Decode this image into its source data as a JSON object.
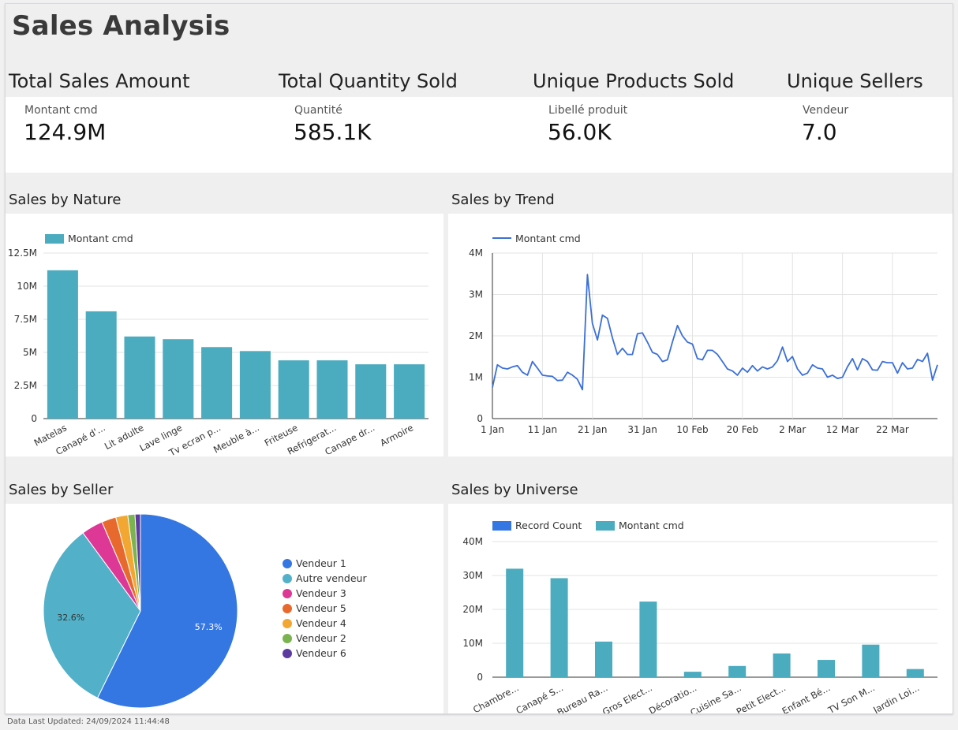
{
  "page": {
    "title": "Sales Analysis",
    "footer": "Data Last Updated: 24/09/2024 11:44:48"
  },
  "kpis": [
    {
      "heading": "Total Sales Amount",
      "label": "Montant cmd",
      "value": "124.9M"
    },
    {
      "heading": "Total Quantity Sold",
      "label": "Quantité",
      "value": "585.1K"
    },
    {
      "heading": "Unique Products Sold",
      "label": "Libellé produit",
      "value": "56.0K"
    },
    {
      "heading": "Unique Sellers",
      "label": "Vendeur",
      "value": "7.0"
    }
  ],
  "sections": {
    "nature": "Sales by Nature",
    "trend": "Sales by Trend",
    "seller": "Sales by Seller",
    "universe": "Sales by Universe"
  },
  "chart_data": [
    {
      "id": "nature",
      "type": "bar",
      "title": "Sales by Nature",
      "categories": [
        "Matelas",
        "Canapé d'...",
        "Lit adulte",
        "Lave linge",
        "Tv ecran p...",
        "Meuble à...",
        "Friteuse",
        "Refrigerat...",
        "Canape dr...",
        "Armoire"
      ],
      "series": [
        {
          "name": "Montant cmd",
          "values": [
            11.2,
            8.1,
            6.2,
            6.0,
            5.4,
            5.1,
            4.4,
            4.4,
            4.1,
            4.1
          ]
        }
      ],
      "unit": "M",
      "ylim": [
        0,
        12.5
      ],
      "yticks": [
        "0",
        "2.5M",
        "5M",
        "7.5M",
        "10M",
        "12.5M"
      ],
      "color": "#4babbf",
      "legend": "top-left",
      "grid": true
    },
    {
      "id": "trend",
      "type": "line",
      "title": "Sales by Trend",
      "series": [
        {
          "name": "Montant cmd",
          "values": [
            0.75,
            1.3,
            1.22,
            1.2,
            1.25,
            1.28,
            1.12,
            1.05,
            1.38,
            1.22,
            1.05,
            1.03,
            1.02,
            0.92,
            0.93,
            1.12,
            1.05,
            0.95,
            0.7,
            3.48,
            2.3,
            1.9,
            2.5,
            2.42,
            1.95,
            1.55,
            1.7,
            1.55,
            1.55,
            2.05,
            2.07,
            1.85,
            1.6,
            1.55,
            1.38,
            1.42,
            1.85,
            2.25,
            2.0,
            1.85,
            1.8,
            1.45,
            1.42,
            1.65,
            1.65,
            1.55,
            1.38,
            1.2,
            1.15,
            1.05,
            1.22,
            1.12,
            1.28,
            1.15,
            1.25,
            1.2,
            1.25,
            1.4,
            1.73,
            1.38,
            1.5,
            1.2,
            1.05,
            1.1,
            1.3,
            1.22,
            1.2,
            1.0,
            1.05,
            0.97,
            1.0,
            1.25,
            1.45,
            1.18,
            1.45,
            1.38,
            1.18,
            1.17,
            1.38,
            1.35,
            1.35,
            1.1,
            1.35,
            1.2,
            1.22,
            1.43,
            1.38,
            1.58,
            0.93,
            1.3
          ]
        }
      ],
      "x_start": "1 Jan",
      "xticks": [
        "1 Jan",
        "11 Jan",
        "21 Jan",
        "31 Jan",
        "10 Feb",
        "20 Feb",
        "2 Mar",
        "12 Mar",
        "22 Mar"
      ],
      "unit": "M",
      "ylim": [
        0,
        4
      ],
      "yticks": [
        "0",
        "1M",
        "2M",
        "3M",
        "4M"
      ],
      "color": "#3b6fd9",
      "legend": "top-left",
      "grid": true
    },
    {
      "id": "seller",
      "type": "pie",
      "title": "Sales by Seller",
      "labels": [
        "Vendeur 1",
        "Autre vendeur",
        "Vendeur 3",
        "Vendeur 5",
        "Vendeur 4",
        "Vendeur 2",
        "Vendeur 6"
      ],
      "values": [
        57.3,
        32.6,
        3.6,
        2.4,
        2.0,
        1.2,
        0.9
      ],
      "data_labels": [
        "57.3%",
        "32.6%",
        "",
        "",
        "",
        "",
        ""
      ],
      "colors": [
        "#3476e2",
        "#52b1c8",
        "#dd3896",
        "#e8692d",
        "#f2a733",
        "#7cb351",
        "#5d3aa0"
      ],
      "legend": "right"
    },
    {
      "id": "universe",
      "type": "bar",
      "title": "Sales by Universe",
      "categories": [
        "Chambre...",
        "Canapé S...",
        "Bureau Ra...",
        "Gros Elect...",
        "Décoratio...",
        "Cuisine Sa...",
        "Petit Elect...",
        "Enfant Bé...",
        "TV Son M...",
        "Jardin Loi..."
      ],
      "series": [
        {
          "name": "Record Count",
          "values": [
            0,
            0,
            0,
            0,
            0,
            0,
            0,
            0,
            0,
            0
          ]
        },
        {
          "name": "Montant cmd",
          "values": [
            32,
            29.2,
            10.5,
            22.3,
            1.6,
            3.3,
            7.0,
            5.1,
            9.6,
            2.4
          ]
        }
      ],
      "unit": "M",
      "ylim": [
        0,
        40
      ],
      "yticks": [
        "0",
        "10M",
        "20M",
        "30M",
        "40M"
      ],
      "colors": [
        "#3476e2",
        "#4babbf"
      ],
      "legend": "top-left",
      "grid": true
    }
  ]
}
